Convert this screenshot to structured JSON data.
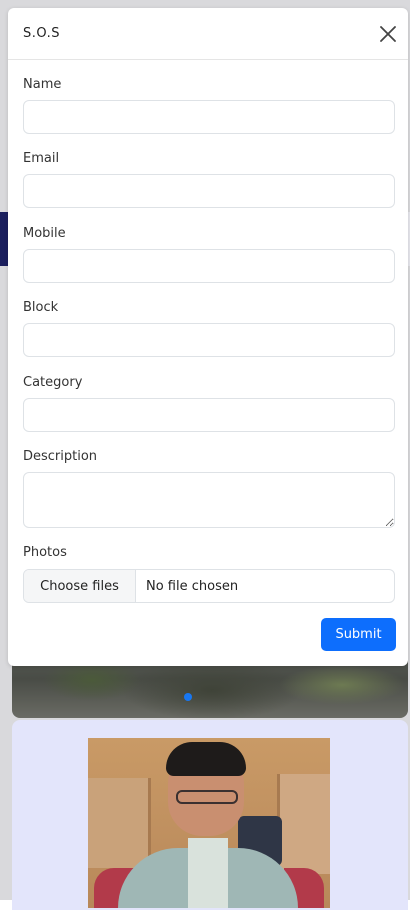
{
  "modal": {
    "title": "S.O.S",
    "close_icon": "close-icon"
  },
  "form": {
    "fields": [
      {
        "label": "Name",
        "value": "",
        "placeholder": ""
      },
      {
        "label": "Email",
        "value": "",
        "placeholder": ""
      },
      {
        "label": "Mobile",
        "value": "",
        "placeholder": ""
      },
      {
        "label": "Block",
        "value": "",
        "placeholder": ""
      },
      {
        "label": "Category",
        "value": "",
        "placeholder": ""
      }
    ],
    "description_label": "Description",
    "description_value": "",
    "photos_label": "Photos",
    "file_button_label": "Choose files",
    "file_status": "No file chosen",
    "submit_label": "Submit"
  },
  "colors": {
    "primary": "#0d6efd",
    "background_card": "#e3e5fb",
    "nav_accent": "#1b1f5e"
  }
}
